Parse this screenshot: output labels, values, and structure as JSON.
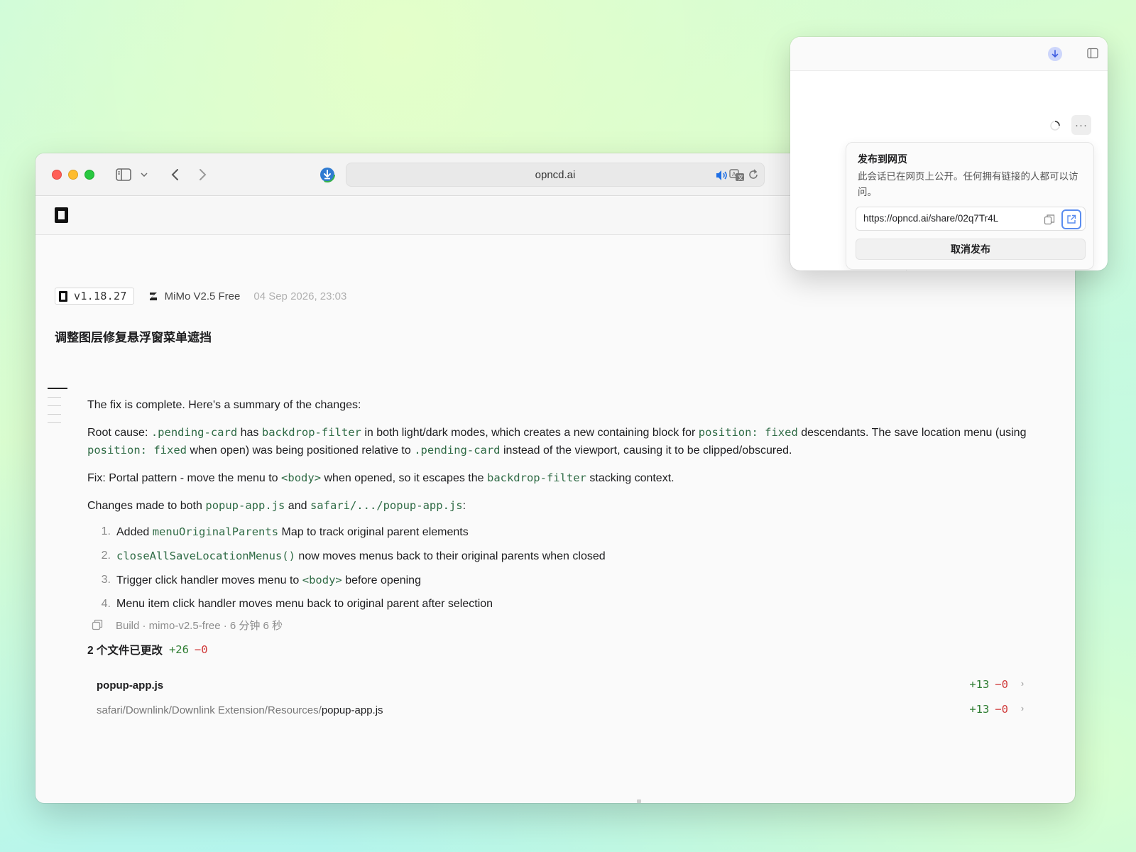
{
  "browser": {
    "address": "opncd.ai"
  },
  "meta": {
    "version": "v1.18.27",
    "model": "MiMo V2.5 Free",
    "timestamp": "04 Sep 2026, 23:03"
  },
  "session": {
    "title": "调整图层修复悬浮窗菜单遮挡"
  },
  "message": {
    "intro": "The fix is complete. Here's a summary of the changes:",
    "root_cause": {
      "label": "Root cause:",
      "code1": ".pending-card",
      "t1": "has",
      "code2": "backdrop-filter",
      "t2": "in both light/dark modes, which creates a new containing block for",
      "code3": "position: fixed",
      "t3": "descendants. The save location menu (using",
      "code4": "position: fixed",
      "t4": "when open) was being positioned relative to",
      "code5": ".pending-card",
      "t5": "instead of the viewport, causing it to be clipped/obscured."
    },
    "fix": {
      "label": "Fix:",
      "t1": "Portal pattern - move the menu to",
      "code1": "<body>",
      "t2": "when opened, so it escapes the",
      "code2": "backdrop-filter",
      "t3": "stacking context."
    },
    "changes": {
      "label": "Changes made",
      "t1": "to both",
      "code1": "popup-app.js",
      "t2": "and",
      "code2": "safari/.../popup-app.js",
      "t3": ":"
    },
    "list": [
      {
        "num": "1.",
        "pre": "Added",
        "code": "menuOriginalParents",
        "post": "Map to track original parent elements"
      },
      {
        "num": "2.",
        "pre": "",
        "code": "closeAllSaveLocationMenus()",
        "post": "now moves menus back to their original parents when closed"
      },
      {
        "num": "3.",
        "pre": "Trigger click handler moves menu to",
        "code": "<body>",
        "post": "before opening"
      },
      {
        "num": "4.",
        "pre": "Menu item click handler moves menu back to original parent after selection",
        "code": "",
        "post": ""
      }
    ]
  },
  "build": {
    "text": "Build · mimo-v2.5-free · 6 分钟 6 秒"
  },
  "diff": {
    "summary_label": "2 个文件已更改",
    "additions": "+26",
    "deletions": "−0",
    "files": [
      {
        "dir": "",
        "name": "popup-app.js",
        "additions": "+13",
        "deletions": "−0"
      },
      {
        "dir": "safari/Downlink/Downlink Extension/Resources/",
        "name": "popup-app.js",
        "additions": "+13",
        "deletions": "−0"
      }
    ]
  },
  "share": {
    "title": "发布到网页",
    "description": "此会话已在网页上公开。任何拥有链接的人都可以访问。",
    "url": "https://opncd.ai/share/02q7Tr4L",
    "unpublish_label": "取消发布",
    "more_label": "···"
  },
  "colors": {
    "code": "#2f6b45",
    "addition": "#2e7d32",
    "deletion": "#d03a3a",
    "accent_blue": "#5b8def"
  }
}
